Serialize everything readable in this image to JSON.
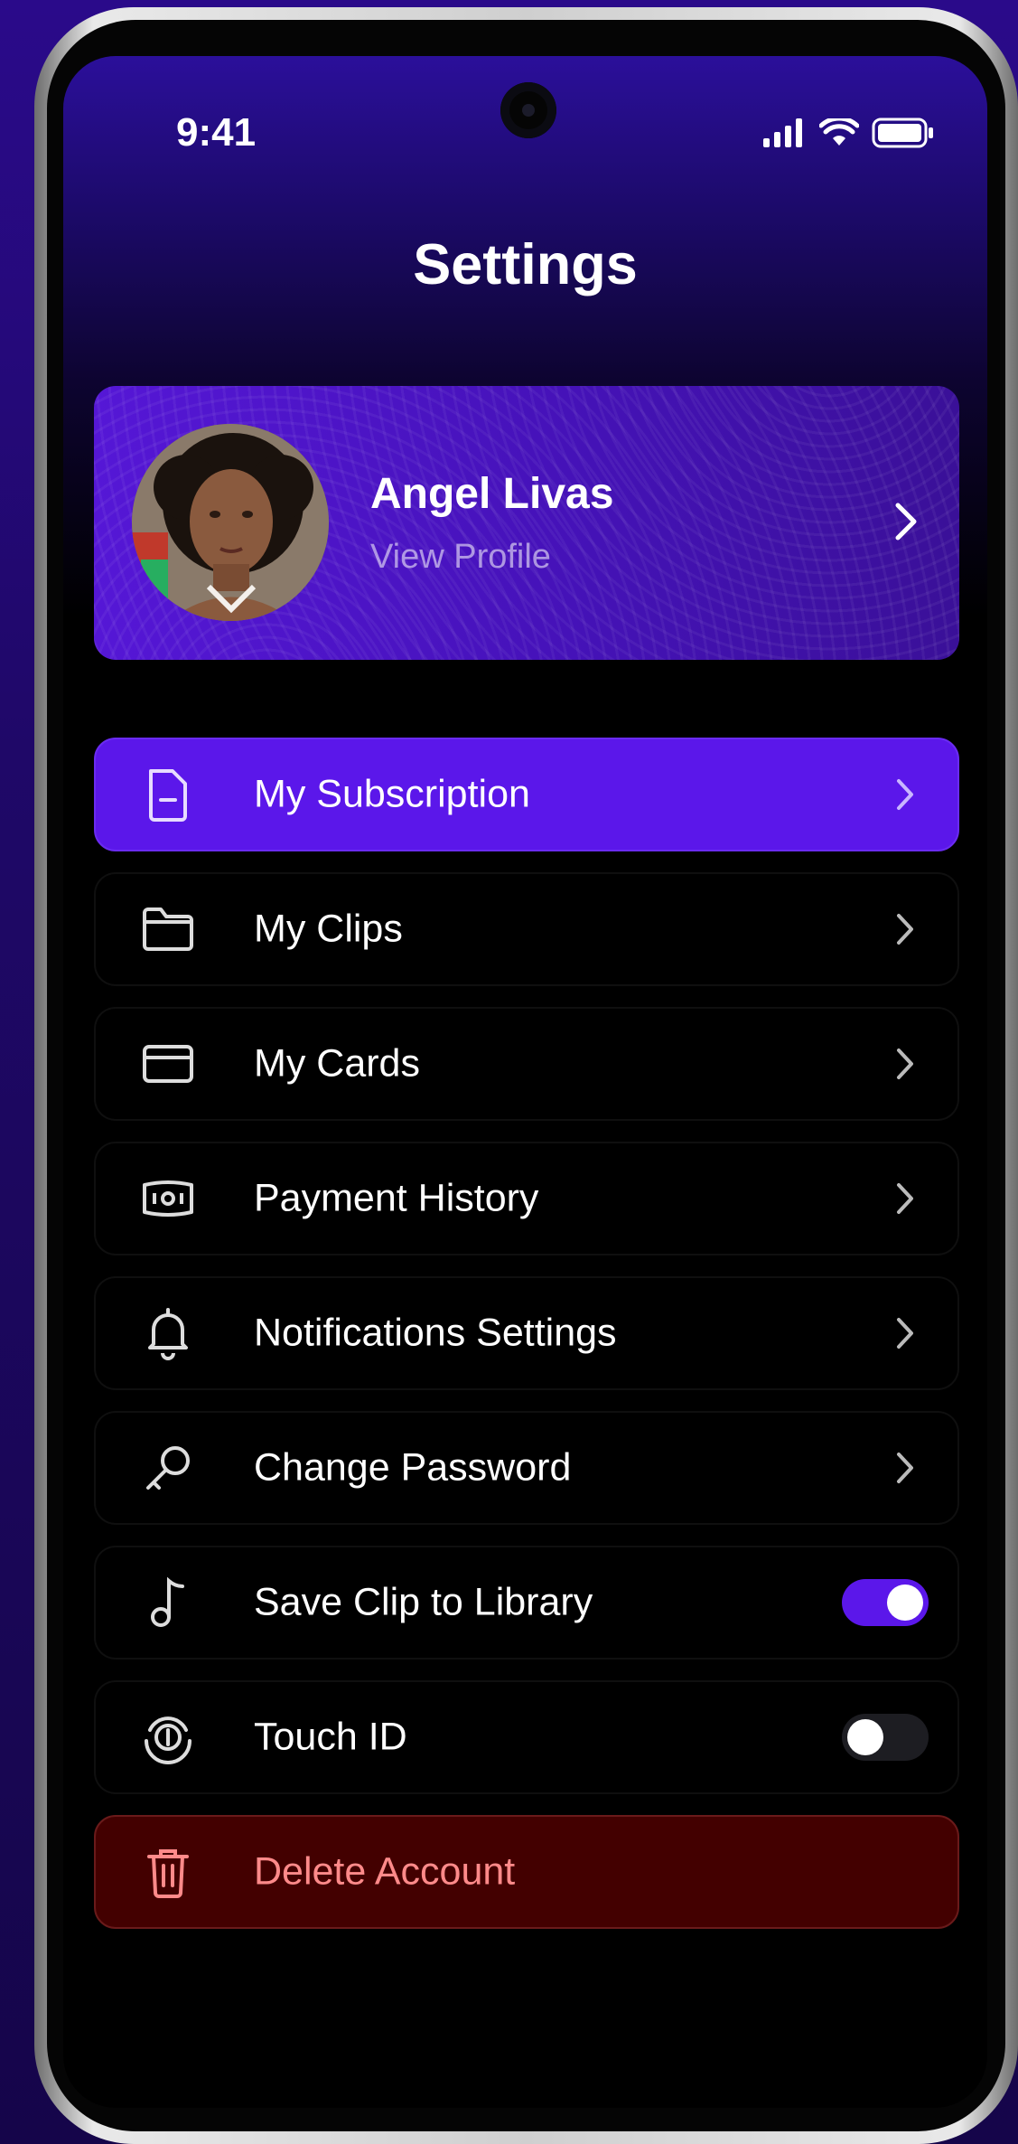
{
  "status_bar": {
    "time": "9:41"
  },
  "header": {
    "title": "Settings"
  },
  "profile": {
    "name": "Angel Livas",
    "subtitle": "View Profile"
  },
  "menu": {
    "items": [
      {
        "label": "My Subscription",
        "icon": "document-icon",
        "control": "chevron",
        "active": true
      },
      {
        "label": "My Clips",
        "icon": "folder-icon",
        "control": "chevron"
      },
      {
        "label": "My Cards",
        "icon": "credit-card-icon",
        "control": "chevron"
      },
      {
        "label": "Payment History",
        "icon": "banknote-icon",
        "control": "chevron"
      },
      {
        "label": "Notifications Settings",
        "icon": "bell-icon",
        "control": "chevron"
      },
      {
        "label": "Change Password",
        "icon": "key-icon",
        "control": "chevron"
      },
      {
        "label": "Save Clip to Library",
        "icon": "music-note-icon",
        "control": "toggle",
        "toggle_on": true
      },
      {
        "label": "Touch ID",
        "icon": "fingerprint-icon",
        "control": "toggle",
        "toggle_on": false
      }
    ],
    "delete": {
      "label": "Delete Account",
      "icon": "trash-icon"
    }
  },
  "colors": {
    "accent": "#5b17ea",
    "danger_bg": "#430000",
    "danger_text": "#ff8a8a"
  }
}
